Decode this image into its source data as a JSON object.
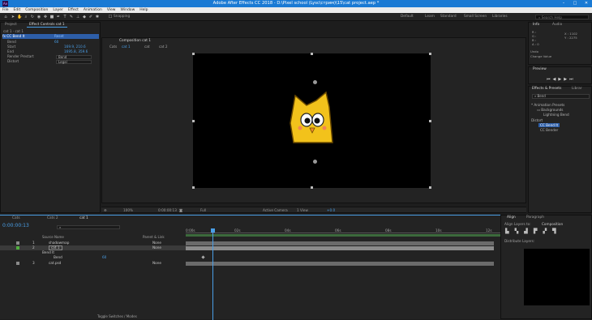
{
  "app": {
    "title": "Adobe After Effects CC 2018 - D:\\Pixel school (Lysc\\стрим)\\15\\cat project.aep *",
    "logo": "Ae"
  },
  "menu": [
    "File",
    "Edit",
    "Composition",
    "Layer",
    "Effect",
    "Animation",
    "View",
    "Window",
    "Help"
  ],
  "toolbar": {
    "snapping": "Snapping",
    "workspaces": [
      "Default",
      "Learn",
      "Standard",
      "Small Screen",
      "Libraries"
    ],
    "search_placeholder": "Search Help"
  },
  "project_panel": {
    "tab": "Project",
    "effects_tab": "Effect Controls cat 1",
    "layer_path": "cat 1 · cat 1",
    "effect_name": "CC Bend It",
    "reset": "Reset",
    "props": [
      {
        "name": "Bend",
        "value": "60"
      },
      {
        "name": "Start",
        "value": "169.9, 210.6"
      },
      {
        "name": "End",
        "value": "1695.8, 359.6"
      },
      {
        "name": "Render Prestart",
        "value": "Bend"
      },
      {
        "name": "Distort",
        "value": "Legal"
      }
    ]
  },
  "composition": {
    "tab": "Composition cat 1",
    "breadcrumbs": [
      "Cats",
      "cat 1",
      "cat",
      "cat 2"
    ],
    "character": {
      "body_color": "#f2c21b",
      "outline_color": "#6b4a00"
    },
    "controls": {
      "zoom": "100%",
      "timecode": "0:00:00:13",
      "resolution": "Full",
      "camera": "Active Camera",
      "views": "1 View",
      "exposure": "+0.0"
    }
  },
  "info_panel": {
    "tabs": [
      "Info",
      "Audio"
    ],
    "readout": [
      "R :",
      "G :",
      "B :",
      "A : 0"
    ],
    "coords": [
      "X : 1102",
      "Y : 2275"
    ],
    "undo_label": "Undo",
    "undo_value": "Change Value"
  },
  "preview_panel": {
    "title": "Preview"
  },
  "effects_presets": {
    "tabs": [
      "Effects & Presets",
      "Librar"
    ],
    "search": "Bend",
    "tree": [
      {
        "label": "* Animation Presets",
        "level": 0
      },
      {
        "label": "Backgrounds",
        "level": 1
      },
      {
        "label": "Lightning Bend",
        "level": 2
      },
      {
        "label": "Distort",
        "level": 0
      },
      {
        "label": "CC Bend It",
        "level": 1,
        "selected": true
      },
      {
        "label": "CC Bender",
        "level": 1
      }
    ]
  },
  "align_panel": {
    "tabs": [
      "Align",
      "Paragraph"
    ],
    "align_to_label": "Align Layers to:",
    "align_to_value": "Composition",
    "distribute_label": "Distribute Layers:"
  },
  "timeline": {
    "tabs": [
      "Cats",
      "Cats 2",
      "cat 1"
    ],
    "timecode": "0:00:00:13",
    "col_headers": [
      "Source Name",
      "Parent & Link"
    ],
    "layers": [
      {
        "num": "1",
        "name": "shadowmap",
        "parent": "None",
        "color": "#8a8a8a"
      },
      {
        "num": "2",
        "name": "cat 1",
        "parent": "None",
        "color": "#4fae3e",
        "selected": true
      },
      {
        "num": "",
        "name": "Bend It",
        "parent": "",
        "color": ""
      },
      {
        "num": "",
        "name": "Bend",
        "parent": "60",
        "color": ""
      },
      {
        "num": "3",
        "name": "cat.psd",
        "parent": "None",
        "color": "#8a8a8a"
      }
    ],
    "ruler": [
      "0:00s",
      "02s",
      "04s",
      "06s",
      "08s",
      "10s",
      "12s"
    ],
    "bottom_label": "Toggle Switches / Modes"
  }
}
